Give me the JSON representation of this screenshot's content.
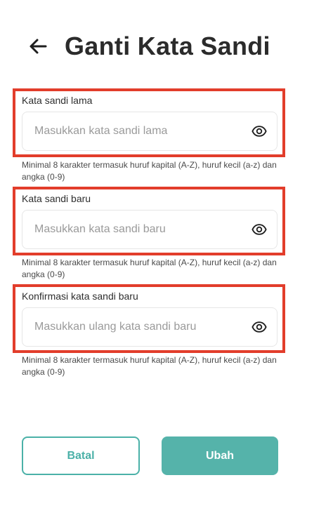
{
  "header": {
    "title": "Ganti Kata Sandi",
    "back_icon": "arrow-left-icon"
  },
  "fields": [
    {
      "label": "Kata sandi lama",
      "placeholder": "Masukkan kata sandi lama",
      "value": "",
      "icon": "eye-icon",
      "hint": "Minimal 8 karakter termasuk huruf kapital (A-Z), huruf kecil (a-z) dan angka (0-9)"
    },
    {
      "label": "Kata sandi baru",
      "placeholder": "Masukkan kata sandi baru",
      "value": "",
      "icon": "eye-icon",
      "hint": "Minimal 8 karakter termasuk huruf kapital (A-Z), huruf kecil (a-z) dan angka (0-9)"
    },
    {
      "label": "Konfirmasi kata sandi baru",
      "placeholder": "Masukkan ulang kata sandi baru",
      "value": "",
      "icon": "eye-icon",
      "hint": "Minimal 8 karakter termasuk huruf kapital (A-Z), huruf kecil (a-z) dan angka (0-9)"
    }
  ],
  "actions": {
    "cancel_label": "Batal",
    "submit_label": "Ubah"
  },
  "colors": {
    "accent": "#55b3aa",
    "highlight": "#e23d2b",
    "title": "#2b2b2b"
  }
}
